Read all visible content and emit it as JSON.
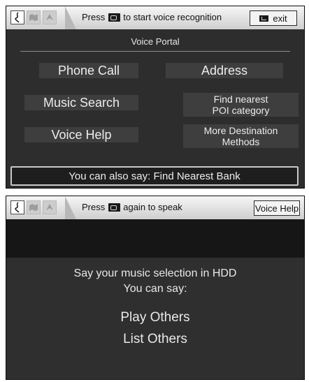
{
  "screen1": {
    "prompt_pre": "Press",
    "prompt_post": "to start voice recognition",
    "exit_label": "exit",
    "title": "Voice Portal",
    "options": {
      "phone_call": "Phone Call",
      "address": "Address",
      "music_search": "Music Search",
      "find_nearest_line1": "Find nearest",
      "find_nearest_line2": "POI category",
      "voice_help": "Voice Help",
      "more_dest_line1": "More Destination",
      "more_dest_line2": "Methods"
    },
    "also_say": "You can also say: Find Nearest Bank"
  },
  "screen2": {
    "prompt_pre": "Press",
    "prompt_post": "again to speak",
    "voice_help_label": "Voice Help",
    "line1": "Say your music selection in HDD",
    "line2": "You can say:",
    "cmd1": "Play Others",
    "cmd2": "List Others"
  },
  "icons": {
    "status1": "voice-talk-icon",
    "status2": "map-icon",
    "status3": "navigation-icon",
    "prompt_button": "talk-button-icon",
    "exit": "back-icon"
  }
}
